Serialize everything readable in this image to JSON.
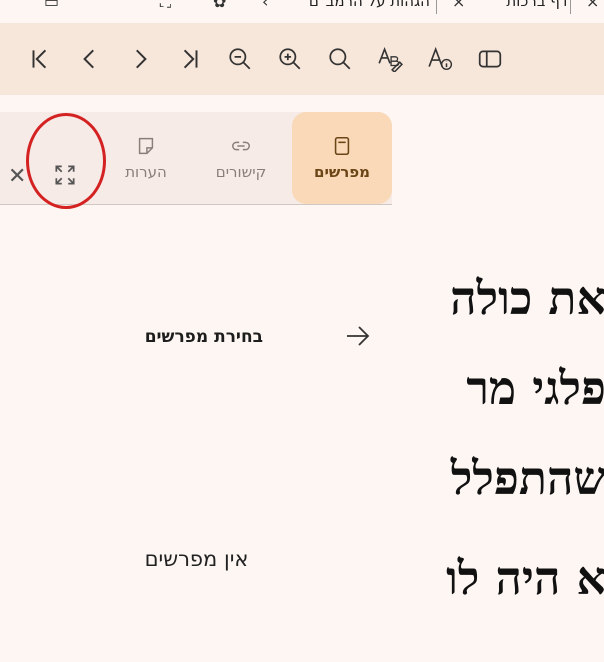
{
  "tab_strip": {
    "tabs": [
      {
        "label": "הגהות על הרמב\"ם"
      },
      {
        "label": "דף ברכות"
      }
    ]
  },
  "toolbar": {
    "buttons": [
      {
        "name": "first-page-button",
        "icon": "first-page-icon"
      },
      {
        "name": "previous-button",
        "icon": "chevron-left-icon"
      },
      {
        "name": "next-button",
        "icon": "chevron-right-icon"
      },
      {
        "name": "last-page-button",
        "icon": "last-page-icon"
      },
      {
        "name": "zoom-out-button",
        "icon": "zoom-out-icon"
      },
      {
        "name": "zoom-in-button",
        "icon": "zoom-in-icon"
      },
      {
        "name": "search-button",
        "icon": "search-icon"
      },
      {
        "name": "text-format-button",
        "icon": "text-format-icon"
      },
      {
        "name": "font-info-button",
        "icon": "font-info-icon"
      },
      {
        "name": "sidebar-toggle-button",
        "icon": "sidebar-icon"
      }
    ]
  },
  "panel": {
    "tabs": [
      {
        "label": "מפרשים",
        "icon": "book-icon",
        "active": true
      },
      {
        "label": "קישורים",
        "icon": "link-icon",
        "active": false
      },
      {
        "label": "הערות",
        "icon": "note-icon",
        "active": false
      }
    ],
    "section_title": "בחירת מפרשים",
    "empty_message": "אין מפרשים"
  },
  "main_text": {
    "lines": [
      "את כולה",
      "פלגי מר",
      "שהתפלל",
      "א היה לו"
    ]
  },
  "colors": {
    "toolbar_bg": "#f7e6da",
    "active_tab_bg": "#f9d9b8",
    "annotation": "#d42121"
  }
}
